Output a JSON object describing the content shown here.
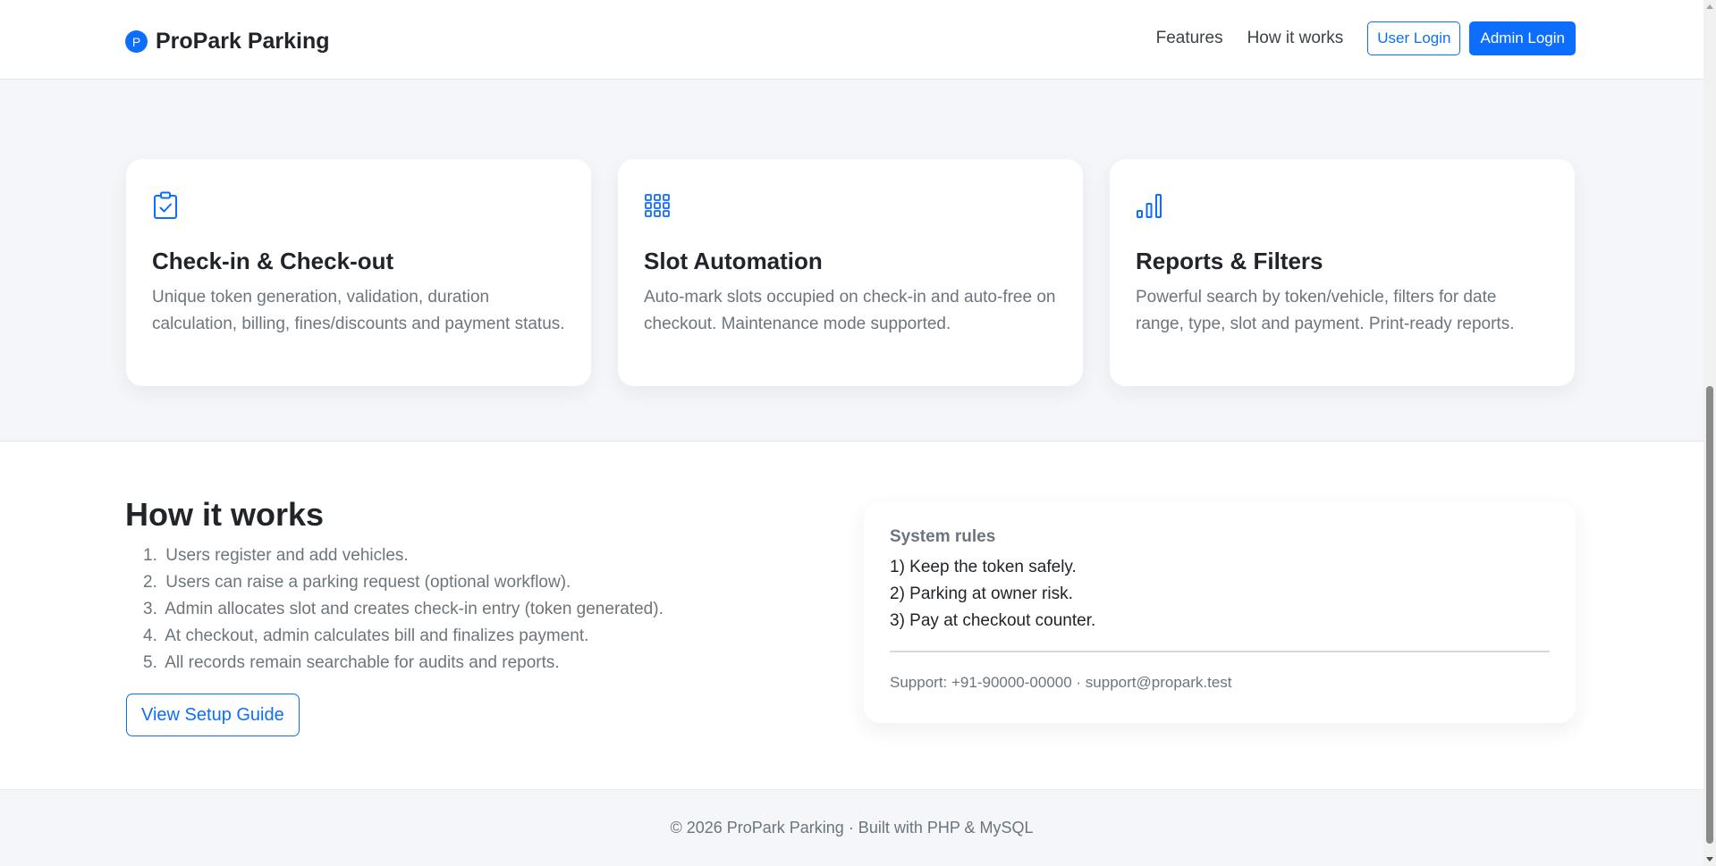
{
  "navbar": {
    "brand_letter": "P",
    "brand_name": "ProPark Parking",
    "links": [
      "Features",
      "How it works"
    ],
    "user_login": "User Login",
    "admin_login": "Admin Login"
  },
  "features": [
    {
      "icon": "clipboard-check-icon",
      "title": "Check-in & Check-out",
      "desc": "Unique token generation, validation, duration calculation, billing, fines/discounts and payment status."
    },
    {
      "icon": "grid-icon",
      "title": "Slot Automation",
      "desc": "Auto-mark slots occupied on check-in and auto-free on checkout. Maintenance mode supported."
    },
    {
      "icon": "bar-chart-icon",
      "title": "Reports & Filters",
      "desc": "Powerful search by token/vehicle, filters for date range, type, slot and payment. Print-ready reports."
    }
  ],
  "how": {
    "title": "How it works",
    "steps": [
      "Users register and add vehicles.",
      "Users can raise a parking request (optional workflow).",
      "Admin allocates slot and creates check-in entry (token generated).",
      "At checkout, admin calculates bill and finalizes payment.",
      "All records remain searchable for audits and reports."
    ],
    "guide_button": "View Setup Guide"
  },
  "rules": {
    "title": "System rules",
    "items": [
      "1) Keep the token safely.",
      "2) Parking at owner risk.",
      "3) Pay at checkout counter."
    ],
    "support": "Support: +91-90000-00000 · support@propark.test"
  },
  "footer": {
    "text": "© 2026 ProPark Parking · Built with PHP & MySQL"
  },
  "colors": {
    "accent": "#0d6efd",
    "text": "#212529",
    "muted": "#6c757d",
    "section_bg": "#f4f6f9"
  }
}
